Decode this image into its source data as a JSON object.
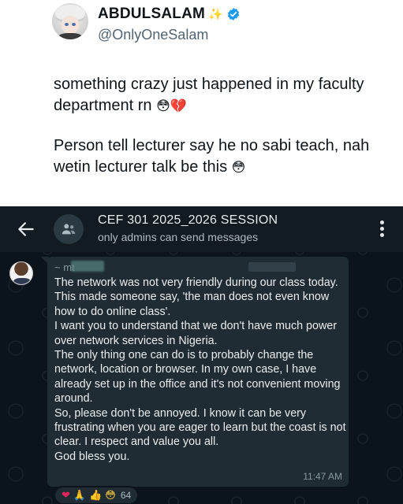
{
  "tweet": {
    "display_name": "ABDULSALAM",
    "sparkle": "✨",
    "handle": "@OnlyOneSalam",
    "text_1": "something crazy just happened in my faculty department rn",
    "emoji_1": "😳💔",
    "text_2": "Person tell lecturer say he no sabi teach, nah wetin lecturer talk be this",
    "emoji_2": "😳"
  },
  "chat": {
    "title": "CEF 301 2025_2026 SESSION",
    "subtitle": "only admins can send messages",
    "sender_prefix": "~ mt",
    "message": "The network was not very friendly during our class today. This made someone say, 'the man does not even know how to do online class'.\nI want you to understand that we don't have much power over network services in Nigeria.\nThe only thing one can do is to probably change the network, location or browser. In my own case, I have already set up in the office and it's not convenient moving around.\nSo, please don't be annoyed. I know it can be very frustrating when you are eager to learn but the coast is not clear. I respect and value you all.\nGod bless you.",
    "time": "11:47 AM",
    "reactions": {
      "heart": "❤",
      "pray": "🙏",
      "thumb": "👍",
      "face": "😳",
      "count": "64"
    }
  },
  "icons": {
    "back": "arrow-left-icon",
    "group": "group-icon",
    "menu": "more-vert-icon",
    "verified": "verified-badge-icon"
  },
  "colors": {
    "verified_blue": "#1d9bf0",
    "chat_bg": "#0b141a",
    "bubble_bg": "#202c33"
  }
}
